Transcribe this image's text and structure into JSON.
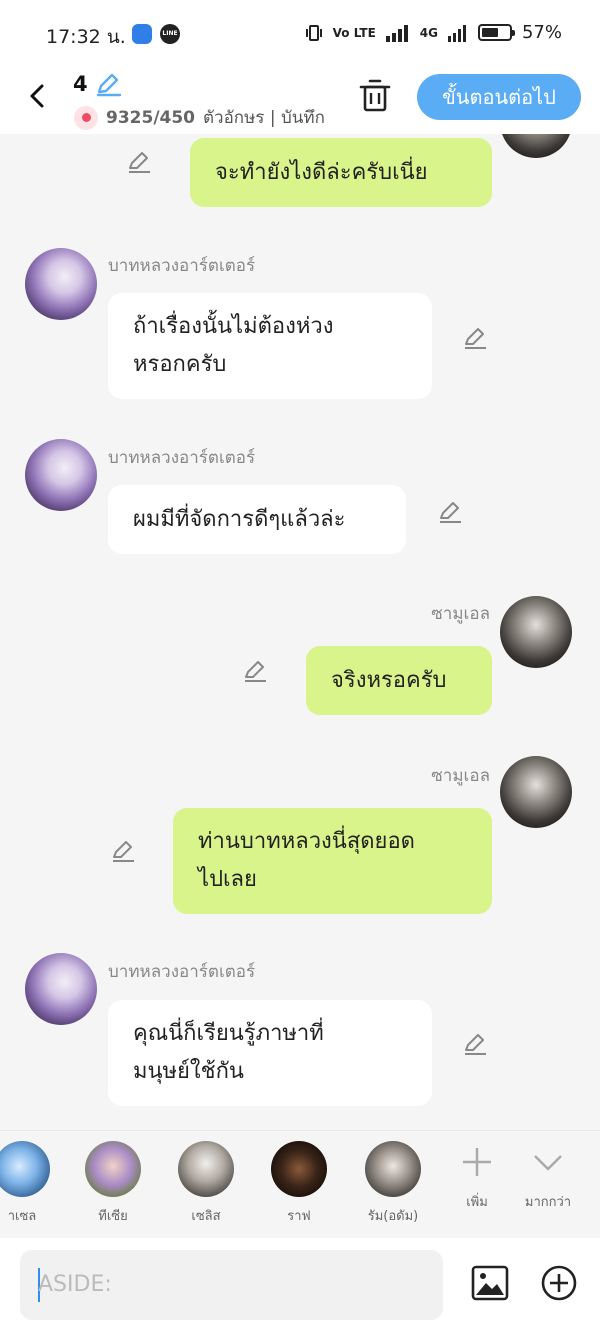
{
  "status_bar": {
    "time": "17:32 น.",
    "line_icon": "LINE",
    "network": "4G",
    "volte": "Vo LTE",
    "battery": "57%"
  },
  "header": {
    "chapter_number": "4",
    "counter": "9325/450",
    "counter_suffix": "ตัวอักษร | บันทึก",
    "next_button": "ขั้นตอนต่อไป"
  },
  "messages": [
    {
      "side": "out",
      "sender": "",
      "text": "จะทำยังไงดีล่ะครับเนี่ย"
    },
    {
      "side": "in",
      "sender": "บาทหลวงอาร์ตเตอร์",
      "text": "ถ้าเรื่องนั้นไม่ต้องห่วงหรอกครับ",
      "lines": [
        "ถ้าเรื่องนั้นไม่ต้องห่วง",
        "หรอกครับ"
      ]
    },
    {
      "side": "in",
      "sender": "บาทหลวงอาร์ตเตอร์",
      "text": "ผมมีที่จัดการดีๆแล้วล่ะ"
    },
    {
      "side": "out",
      "sender": "ซามูเอล",
      "text": "จริงหรอครับ"
    },
    {
      "side": "out",
      "sender": "ซามูเอล",
      "text": "ท่านบาทหลวงนี่สุดยอดไปเลย",
      "lines": [
        "ท่านบาทหลวงนี่สุดยอด",
        "ไปเลย"
      ]
    },
    {
      "side": "in",
      "sender": "บาทหลวงอาร์ตเตอร์",
      "text": "คุณนี่ก็เรียนรู้ภาษาที่มนุษย์ใช้กัน",
      "lines": [
        "คุณนี่ก็เรียนรู้ภาษาที่",
        "มนุษย์ใช้กัน"
      ]
    }
  ],
  "characters": [
    {
      "label": "าเซล"
    },
    {
      "label": "ทีเซีย"
    },
    {
      "label": "เซลิส"
    },
    {
      "label": "ราฟ"
    },
    {
      "label": "รัม(อดัม)"
    }
  ],
  "strip_tools": {
    "add_label": "เพิ่ม",
    "more_label": "มากกว่า"
  },
  "input": {
    "placeholder": "ASIDE:"
  },
  "colors": {
    "accent": "#5aacf5",
    "outgoing_bubble": "#d8f48a",
    "incoming_bubble": "#ffffff",
    "background": "#f5f5f5"
  },
  "icons": [
    "back-arrow-icon",
    "pencil-icon",
    "bell-icon",
    "trash-icon",
    "image-icon",
    "plus-circle-icon",
    "plus-icon",
    "chevron-down-icon"
  ]
}
